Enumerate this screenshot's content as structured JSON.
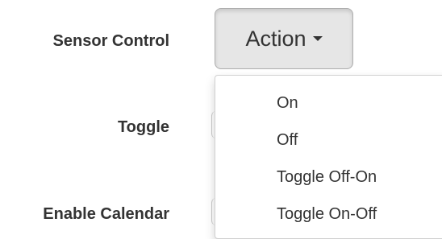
{
  "form": {
    "sensor_control_label": "Sensor Control",
    "toggle_label": "Toggle",
    "enable_calendar_label": "Enable Calendar"
  },
  "action_button": {
    "label": "Action",
    "icon": "caret-down-icon"
  },
  "dropdown": {
    "items": [
      {
        "label": "On"
      },
      {
        "label": "Off"
      },
      {
        "label": "Toggle Off-On"
      },
      {
        "label": "Toggle On-Off"
      }
    ]
  },
  "colors": {
    "text": "#333333",
    "button_active_bg": "#e6e6e6",
    "button_border": "#adadad",
    "menu_border": "#d0d0d0"
  }
}
